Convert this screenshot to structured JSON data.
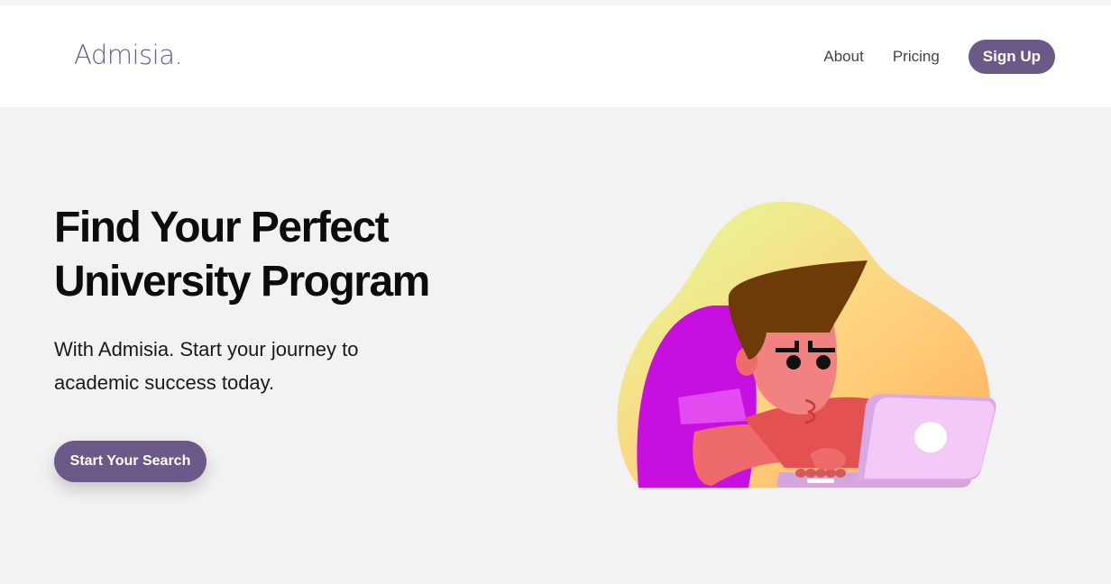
{
  "brand": {
    "logo_text": "Admisia."
  },
  "nav": {
    "about_label": "About",
    "pricing_label": "Pricing",
    "signup_label": "Sign Up"
  },
  "hero": {
    "title": "Find Your Perfect University Program",
    "subtitle": "With Admisia. Start your journey to academic success today.",
    "cta_label": "Start Your Search"
  },
  "illustration": {
    "name": "student-typing-on-laptop-illustration",
    "blob_colors": [
      "#e0ff9a",
      "#ffd27f",
      "#ffae5a"
    ],
    "shirt_color": "#c70fe0",
    "hair_color": "#6e3b08",
    "laptop_color": "#f2c9f7"
  },
  "colors": {
    "accent": "#6b5987",
    "header_bg": "#ffffff",
    "page_bg": "#f2f2f2"
  }
}
